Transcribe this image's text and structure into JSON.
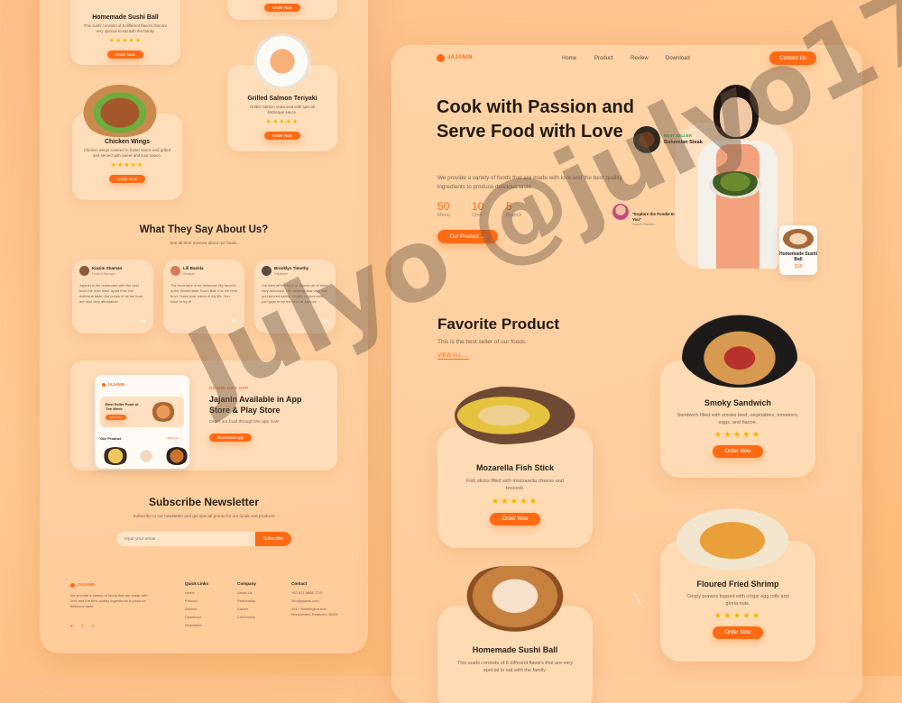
{
  "left": {
    "sushi_card": {
      "title": "Homemade Sushi Ball",
      "desc": "This sushi consists of 8 different flavors that are very special to eat with the family.",
      "stars": "★★★★★",
      "button": "Order Now"
    },
    "top_card": {
      "button": "Order Now"
    },
    "salmon_card": {
      "title": "Grilled Salmon Teriyaki",
      "desc": "Grilled salmon seasoned with special barbeque sauce.",
      "stars": "★★★★★",
      "button": "Order Now"
    },
    "wings_card": {
      "title": "Chicken Wings",
      "desc": "Chicken wings covered in butter sauce and grilled and served with sweet and sour sauce.",
      "stars": "★★★★★",
      "button": "Order Now"
    },
    "testimonials": {
      "title": "What They Say About Us?",
      "subtitle": "See all their reviews about our foods.",
      "items": [
        {
          "name": "Kiazim Shaman",
          "role": "Product Manager",
          "text": "Jajanin is the restaurant with the best food I've ever tried, apart from the delicious taste, the prices of all the food are also very affordable!"
        },
        {
          "name": "Lili Basida",
          "role": "Designer",
          "text": "The food here is so delicious! My favorite is the Homemade Sushi Ball, it is the best food I have ever eaten in my life. You have to try it!"
        },
        {
          "name": "Brooklyn Timothy",
          "role": "Influencer",
          "text": "I've tried all the food at Jajanin all of them very delicious! The delivery was very fast and arrived safely. I highly recommend you guys to try the food at Jajanin!"
        }
      ]
    },
    "app_promo": {
      "mock_logo": "JAJANIN",
      "mock_banner": "Best Seller Food of The Week",
      "mock_banner_button": "Order Now",
      "mock_section": "Our Product",
      "mock_view_all": "VIEW ALL →",
      "eyebrow": "DOWNLOAD APP",
      "title": "Jajanin Available in App Store & Play Store",
      "desc": "Order our food through the app now!",
      "button": "Download App"
    },
    "newsletter": {
      "title": "Subscribe Newsletter",
      "desc": "Subscribe to our newsletter and get special promo for our foods and products",
      "placeholder": "Input your email...",
      "button": "Subscribe"
    },
    "footer": {
      "logo": "JAJANIN",
      "about": "We provide a variety of foods that are made with love and the best quality ingredients to produce delicious taste.",
      "socials": [
        "●",
        "f",
        "t"
      ],
      "quick_links": {
        "title": "Quick Links",
        "items": [
          "Home",
          "Product",
          "Review",
          "Download",
          "Newsletter"
        ]
      },
      "company": {
        "title": "Company",
        "items": [
          "About Us",
          "Partnership",
          "Career",
          "Community"
        ]
      },
      "contact": {
        "title": "Contact",
        "items": [
          "+62 821 8888 7710",
          "info@jajanin.com",
          "4517 Washington Ave. Manchester, Kentucky 39495"
        ]
      }
    }
  },
  "right": {
    "brand": "JAJANIN",
    "nav": [
      "Home",
      "Product",
      "Review",
      "Download"
    ],
    "contact_button": "Contact Us",
    "hero": {
      "title": "Cook with Passion and Serve Food with Love",
      "desc": "We provide a variety of foods that are made with love and the best quality ingredients to produce delicious taste.",
      "stats": [
        {
          "num": "50",
          "label": "Menu"
        },
        {
          "num": "10",
          "label": "Chef"
        },
        {
          "num": "5",
          "label": "Branch"
        }
      ],
      "button": "Our Product →",
      "best_seller_tag": "BEST SELLER",
      "best_seller_name": "Bohemian Steak",
      "quote_text": "\"Explore the Foodie In You\"",
      "quote_author": "Kiazim Shaman",
      "mini_card_title": "Homemade Sushi Ball",
      "mini_card_price": "$18"
    },
    "favorites": {
      "title": "Favorite Product",
      "subtitle": "This is the best seller of our foods.",
      "view_all": "VIEW ALL →",
      "items": [
        {
          "title": "Mozarella Fish Stick",
          "desc": "Fish sticks filled with mozzarella cheese and broccoli.",
          "stars": "★★★★★",
          "button": "Order Now"
        },
        {
          "title": "Smoky Sandwich",
          "desc": "Sandwich filled with smoke beef, vegetables, tomatoes, eggs, and bacon.",
          "stars": "★★★★★",
          "button": "Order Now"
        },
        {
          "title": "Floured Fried Shrimp",
          "desc": "Crispy prawns topped with crispy egg rolls and gloria nuts.",
          "stars": "★★★★★",
          "button": "Order Now"
        },
        {
          "title": "Homemade Sushi Ball",
          "desc": "This sushi consists of 8 different flavors that are very special to eat with the family.",
          "stars": "",
          "button": ""
        }
      ]
    }
  },
  "watermark": "Julyo @julyo17",
  "colors": {
    "accent": "#ff6a14",
    "star": "#f5b300",
    "text": "#231a12",
    "background": "#ffc08a"
  }
}
